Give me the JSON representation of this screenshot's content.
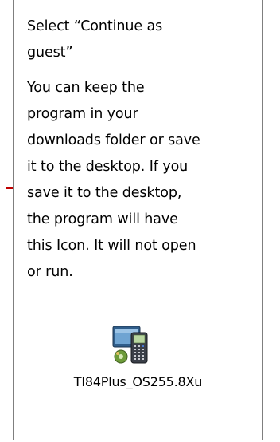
{
  "instruction": {
    "step": "Select “Continue as\nguest”",
    "note": "You can keep the\nprogram in your\ndownloads folder or save\nit to the desktop.  If you\nsave it to the desktop,\nthe program will have\nthis Icon.  It will not open\nor run."
  },
  "file": {
    "icon": "ti84-calculator-file-icon",
    "name": "TI84Plus_OS255.8Xu"
  },
  "colors": {
    "border": "#7f7f7f",
    "connector": "#c00000"
  }
}
